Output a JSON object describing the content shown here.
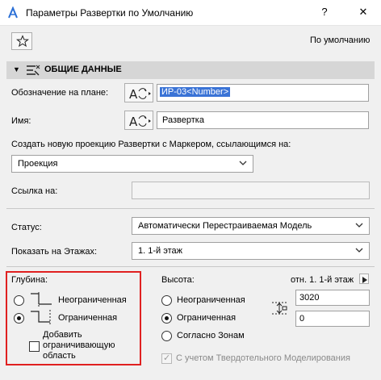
{
  "window": {
    "title": "Параметры Развертки по Умолчанию",
    "help_label": "?",
    "close_label": "✕"
  },
  "toolbar": {
    "favorites_icon": "star-icon",
    "default_label": "По умолчанию"
  },
  "section": {
    "title": "ОБЩИЕ ДАННЫЕ"
  },
  "plan_id": {
    "label": "Обозначение на плане:",
    "value": "ИР-03<Number>"
  },
  "name": {
    "label": "Имя:",
    "value": "Развертка"
  },
  "create_projection": {
    "label": "Создать новую проекцию Развертки с Маркером, ссылающимся на:",
    "selected": "Проекция"
  },
  "reference": {
    "label": "Ссылка на:",
    "value": ""
  },
  "status": {
    "label": "Статус:",
    "selected": "Автоматически Перестраиваемая Модель"
  },
  "show_on_stories": {
    "label": "Показать на Этажах:",
    "selected": "1. 1-й этаж"
  },
  "depth": {
    "label": "Глубина:",
    "options": [
      "Неограниченная",
      "Ограниченная"
    ],
    "selected_index": 1,
    "add_boundary_label_1": "Добавить",
    "add_boundary_label_2": "ограничивающую",
    "add_boundary_label_3": "область",
    "add_boundary_checked": false
  },
  "height": {
    "label": "Высота:",
    "options": [
      "Неограниченная",
      "Ограниченная",
      "Согласно Зонам"
    ],
    "selected_index": 1,
    "reference_label": "отн. 1. 1-й этаж",
    "top_value": "3020",
    "bottom_value": "0",
    "solid_ops_label": "С учетом Твердотельного Моделирования",
    "solid_ops_checked": true,
    "solid_ops_enabled": false
  },
  "colors": {
    "selection": "#3a73d6",
    "highlight_border": "#e02020"
  }
}
